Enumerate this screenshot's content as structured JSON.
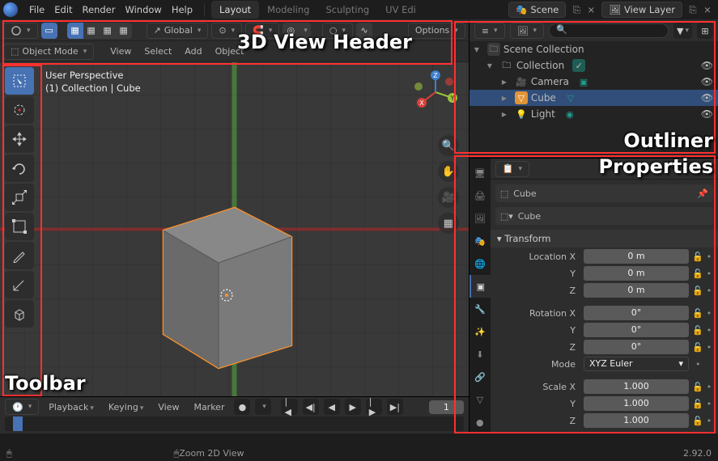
{
  "topbar": {
    "menus": [
      "File",
      "Edit",
      "Render",
      "Window",
      "Help"
    ],
    "tabs": [
      "Layout",
      "Modeling",
      "Sculpting",
      "UV Edi"
    ],
    "active_tab": 0,
    "scene_icon": "🎭",
    "scene_label": "Scene",
    "layer_icon": "🖼",
    "layer_label": "View Layer"
  },
  "header3d": {
    "orientation": "Global",
    "options_btn": "Options",
    "mode": "Object Mode",
    "menus": [
      "View",
      "Select",
      "Add",
      "Object"
    ]
  },
  "viewport": {
    "line1": "User Perspective",
    "line2": "(1) Collection | Cube",
    "gizmo": {
      "x": "X",
      "y": "Y",
      "z": "Z"
    }
  },
  "outliner": {
    "root": "Scene Collection",
    "coll": "Collection",
    "items": [
      {
        "icon": "🎥",
        "name": "Camera",
        "color": "#86b86a"
      },
      {
        "icon": "▽",
        "name": "Cube",
        "color": "#e19336",
        "sel": true
      },
      {
        "icon": "💡",
        "name": "Light",
        "color": "#e1c23e"
      }
    ]
  },
  "props": {
    "obj_name": "Cube",
    "crumb_name": "Cube",
    "panel_title": "Transform",
    "loc_label": "Location X",
    "rot_label": "Rotation X",
    "scale_label": "Scale X",
    "mode_label": "Mode",
    "deg_unit": "°",
    "loc": [
      "0 m",
      "0 m",
      "0 m"
    ],
    "rot": [
      "0°",
      "0°",
      "0°"
    ],
    "scale": [
      "1.000",
      "1.000",
      "1.000"
    ],
    "mode_value": "XYZ Euler",
    "axes": [
      "Y",
      "Z"
    ]
  },
  "timeline": {
    "menus": [
      "Playback",
      "Keying",
      "View",
      "Marker"
    ],
    "frame": "1"
  },
  "status": {
    "hint": "Zoom 2D View",
    "version": "2.92.0"
  },
  "annotations": {
    "header": "3D View Header",
    "toolbar": "Toolbar",
    "outliner": "Outliner",
    "properties": "Properties"
  }
}
